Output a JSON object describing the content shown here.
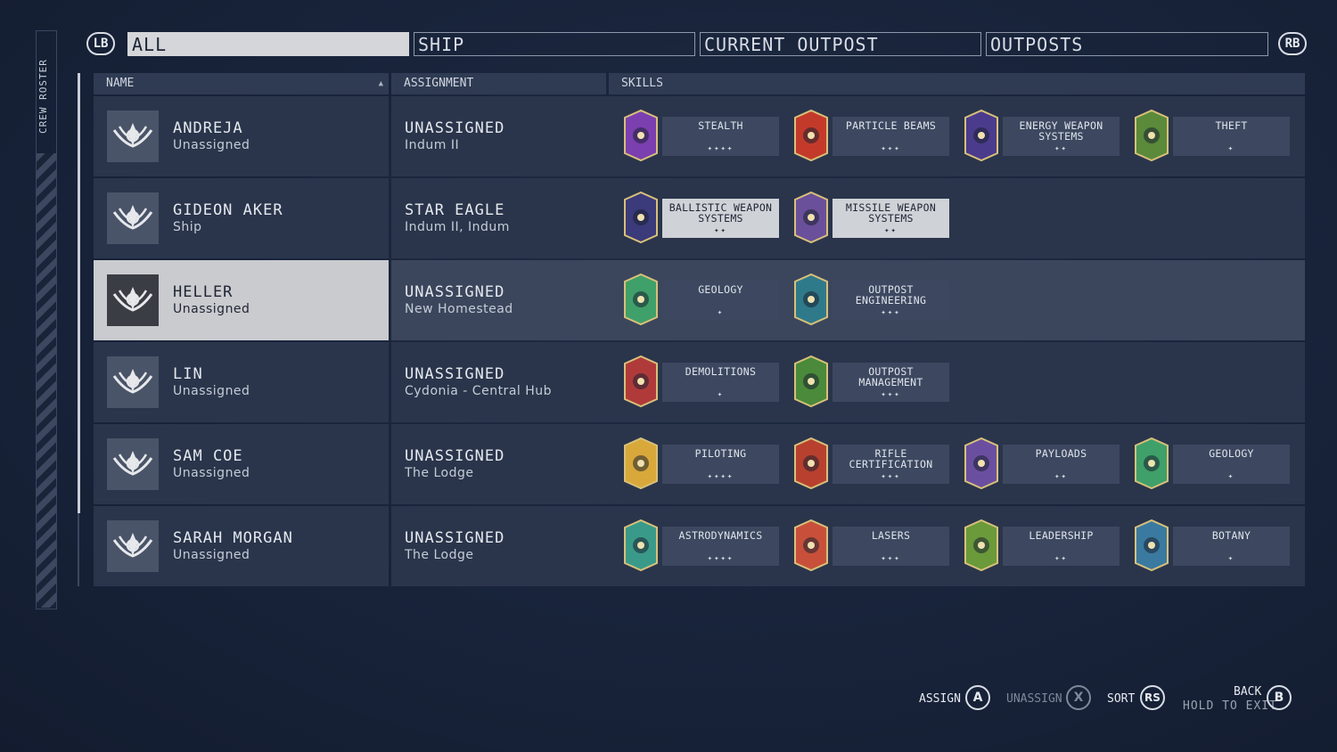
{
  "side_label": "CREW ROSTER",
  "bumpers": {
    "left": "LB",
    "right": "RB"
  },
  "tabs": [
    "ALL",
    "SHIP",
    "CURRENT OUTPOST",
    "OUTPOSTS"
  ],
  "columns": {
    "name": "NAME",
    "assignment": "ASSIGNMENT",
    "skills": "SKILLS"
  },
  "crew": [
    {
      "name": "ANDREJA",
      "status": "Unassigned",
      "assignment": "UNASSIGNED",
      "location": "Indum II",
      "skills": [
        {
          "name": "STEALTH",
          "stars": "✦✦✦✦",
          "icon": "cat-assassin-icon",
          "color": "#7b3fb0"
        },
        {
          "name": "PARTICLE BEAMS",
          "stars": "✦✦✦",
          "icon": "beam-burst-icon",
          "color": "#c43a2a"
        },
        {
          "name": "ENERGY WEAPON\nSYSTEMS",
          "stars": "✦✦",
          "icon": "energy-ship-icon",
          "color": "#4b3b8c"
        },
        {
          "name": "THEFT",
          "stars": "✦",
          "icon": "hand-grab-icon",
          "color": "#5a8a3a"
        }
      ]
    },
    {
      "name": "GIDEON AKER",
      "status": "Ship",
      "assignment": "STAR EAGLE",
      "location": "Indum II, Indum",
      "skills": [
        {
          "name": "BALLISTIC WEAPON\nSYSTEMS",
          "stars": "✦✦",
          "icon": "ballistic-ship-icon",
          "color": "#3b3a7a",
          "light": true
        },
        {
          "name": "MISSILE WEAPON\nSYSTEMS",
          "stars": "✦✦",
          "icon": "missile-planet-icon",
          "color": "#6a4f9a",
          "light": true
        }
      ]
    },
    {
      "name": "HELLER",
      "status": "Unassigned",
      "assignment": "UNASSIGNED",
      "location": "New Homestead",
      "selected": true,
      "skills": [
        {
          "name": "GEOLOGY",
          "stars": "✦",
          "icon": "crystal-icon",
          "color": "#3fa06a"
        },
        {
          "name": "OUTPOST\nENGINEERING",
          "stars": "✦✦✦",
          "icon": "outpost-dome-icon",
          "color": "#2f7a8a"
        }
      ]
    },
    {
      "name": "LIN",
      "status": "Unassigned",
      "assignment": "UNASSIGNED",
      "location": "Cydonia - Central Hub",
      "skills": [
        {
          "name": "DEMOLITIONS",
          "stars": "✦",
          "icon": "grenade-icon",
          "color": "#b03a3a"
        },
        {
          "name": "OUTPOST\nMANAGEMENT",
          "stars": "✦✦✦",
          "icon": "outpost-base-icon",
          "color": "#4a8a3a"
        }
      ]
    },
    {
      "name": "SAM COE",
      "status": "Unassigned",
      "assignment": "UNASSIGNED",
      "location": "The Lodge",
      "skills": [
        {
          "name": "PILOTING",
          "stars": "✦✦✦✦",
          "icon": "spaceship-icon",
          "color": "#d9a83a"
        },
        {
          "name": "RIFLE\nCERTIFICATION",
          "stars": "✦✦✦",
          "icon": "crossed-rifles-icon",
          "color": "#b8402e"
        },
        {
          "name": "PAYLOADS",
          "stars": "✦✦",
          "icon": "rocket-icon",
          "color": "#6a4fa0"
        },
        {
          "name": "GEOLOGY",
          "stars": "✦",
          "icon": "crystal-icon",
          "color": "#3fa06a"
        }
      ]
    },
    {
      "name": "SARAH MORGAN",
      "status": "Unassigned",
      "assignment": "UNASSIGNED",
      "location": "The Lodge",
      "skills": [
        {
          "name": "ASTRODYNAMICS",
          "stars": "✦✦✦✦",
          "icon": "orbit-station-icon",
          "color": "#3a9a8a"
        },
        {
          "name": "LASERS",
          "stars": "✦✦✦",
          "icon": "laser-burst-icon",
          "color": "#c8503a"
        },
        {
          "name": "LEADERSHIP",
          "stars": "✦✦",
          "icon": "flag-soldier-icon",
          "color": "#6a9a3a"
        },
        {
          "name": "BOTANY",
          "stars": "✦",
          "icon": "flower-icon",
          "color": "#3a7aa0"
        }
      ]
    }
  ],
  "footer": {
    "assign_label": "ASSIGN",
    "assign_key": "A",
    "unassign_label": "UNASSIGN",
    "unassign_key": "X",
    "sort_label": "SORT",
    "sort_key": "RS",
    "back_label": "BACK",
    "hold_label": "HOLD TO EXIT",
    "back_key": "B"
  }
}
